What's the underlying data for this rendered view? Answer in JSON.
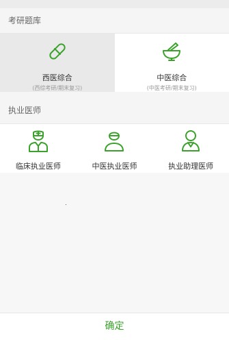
{
  "sections": {
    "kaoyan": {
      "header": "考研题库",
      "cards": [
        {
          "title": "西医综合",
          "subtitle": "(西综考研/期末复习)",
          "icon": "pill-capsule-icon",
          "selected": true
        },
        {
          "title": "中医综合",
          "subtitle": "(中医考研/期末复习)",
          "icon": "mortar-pestle-icon",
          "selected": false
        }
      ]
    },
    "zhiye": {
      "header": "执业医师",
      "items": [
        {
          "label": "临床执业医师",
          "icon": "nurse-doctor-icon"
        },
        {
          "label": "中医执业医师",
          "icon": "doctor-cap-icon"
        },
        {
          "label": "执业助理医师",
          "icon": "assistant-doctor-icon"
        }
      ]
    }
  },
  "confirm_label": "确定",
  "colors": {
    "accent": "#3aa12a",
    "selected_bg": "#e9e9e9"
  }
}
